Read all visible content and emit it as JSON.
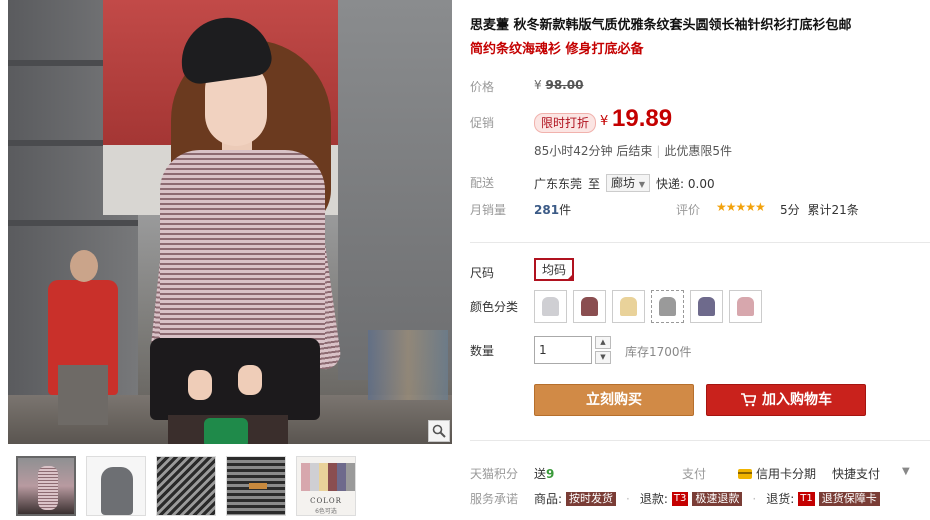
{
  "product": {
    "title": "思麦薹 秋冬新款韩版气质优雅条纹套头圆领长袖针织衫打底衫包邮",
    "subtitle": "简约条纹海魂衫 修身打底必备"
  },
  "price": {
    "label": "价格",
    "currency": "¥",
    "original": "98.00"
  },
  "promo": {
    "label": "促销",
    "tag": "限时打折",
    "currency": "¥",
    "price": "19.89",
    "countdown": "85小时42分钟 后结束",
    "limit": "此优惠限5件"
  },
  "shipping": {
    "label": "配送",
    "from": "广东东莞",
    "to_word": "至",
    "destination": "廊坊",
    "express": "快递: 0.00"
  },
  "sales": {
    "label": "月销量",
    "count": "281",
    "unit": "件",
    "review_label": "评价",
    "stars": "★★★★★",
    "score": "5分",
    "reviews": "累计21条"
  },
  "options": {
    "size_label": "尺码",
    "size_value": "均码",
    "color_label": "颜色分类",
    "colors": [
      "#cfcfd3",
      "#8a4e50",
      "#e9d29a",
      "#9a9a9a",
      "#6e6a8c",
      "#d7a7ad"
    ],
    "qty_label": "数量",
    "qty_value": "1",
    "stock": "库存1700件"
  },
  "actions": {
    "buy_now": "立刻购买",
    "add_cart": "加入购物车"
  },
  "footer": {
    "points_label": "天猫积分",
    "points_text": "送",
    "points_value": "9",
    "pay_label": "支付",
    "credit": "信用卡分期",
    "quickpay": "快捷支付",
    "service_label": "服务承诺",
    "svc1_text": "商品:",
    "svc1_tag": "按时发货",
    "svc2_text": "退款:",
    "svc2_badge": "T3",
    "svc2_tag": "极速退款",
    "svc3_text": "退货:",
    "svc3_badge": "T1",
    "svc3_tag": "退货保障卡"
  },
  "thumbnails": {
    "t5_label": "COLOR",
    "t5_sub": "6色可选",
    "t5_colors": [
      "#d7a7ad",
      "#cfcfd3",
      "#e9d29a",
      "#8a4e50",
      "#6e6a8c",
      "#9a9a9a"
    ]
  }
}
